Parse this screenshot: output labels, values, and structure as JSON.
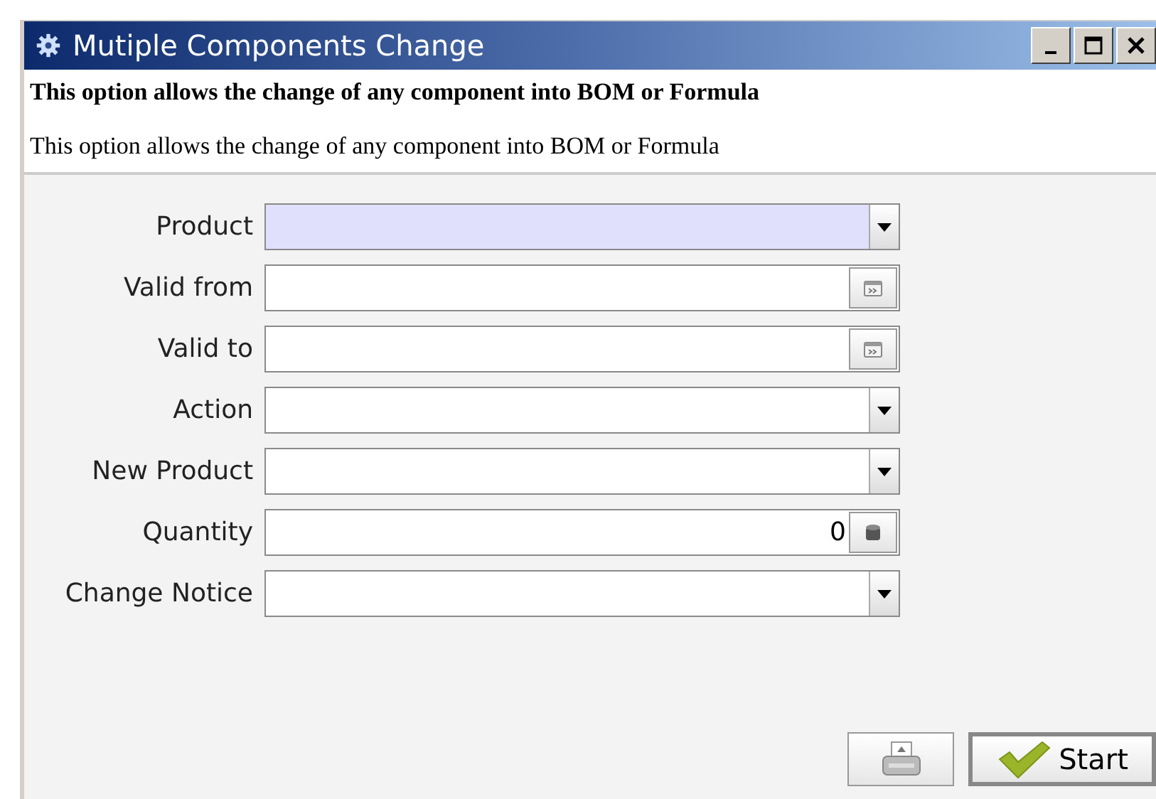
{
  "window": {
    "title": "Mutiple Components Change"
  },
  "header": {
    "title": "This option allows the change of any component into BOM or Formula",
    "description": "This option allows the change of any component into BOM or Formula"
  },
  "fields": [
    {
      "label": "Product",
      "kind": "combo",
      "mandatory": true
    },
    {
      "label": "Valid from",
      "kind": "date",
      "mandatory": false
    },
    {
      "label": "Valid to",
      "kind": "date",
      "mandatory": false
    },
    {
      "label": "Action",
      "kind": "combo",
      "mandatory": false
    },
    {
      "label": "New Product",
      "kind": "combo",
      "mandatory": false
    },
    {
      "label": "Quantity",
      "kind": "number",
      "mandatory": false,
      "value": "0"
    },
    {
      "label": "Change Notice",
      "kind": "combo",
      "mandatory": false
    }
  ],
  "buttons": [
    {
      "kind": "print"
    },
    {
      "kind": "start",
      "label": "Start"
    }
  ]
}
